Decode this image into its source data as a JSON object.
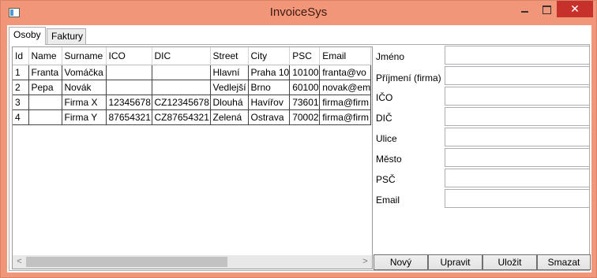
{
  "window": {
    "title": "InvoiceSys",
    "close_glyph": "✕"
  },
  "tabs": [
    {
      "label": "Osoby",
      "active": true
    },
    {
      "label": "Faktury",
      "active": false
    }
  ],
  "grid": {
    "columns": [
      "Id",
      "Name",
      "Surname",
      "ICO",
      "DIC",
      "Street",
      "City",
      "PSC",
      "Email"
    ],
    "rows": [
      [
        "1",
        "Franta",
        "Vomáčka",
        "",
        "",
        "Hlavní",
        "Praha 10",
        "10100",
        "franta@vo"
      ],
      [
        "2",
        "Pepa",
        "Novák",
        "",
        "",
        "Vedlejší",
        "Brno",
        "60100",
        "novak@em"
      ],
      [
        "3",
        "",
        "Firma X",
        "12345678",
        "CZ12345678",
        "Dlouhá",
        "Havířov",
        "73601",
        "firma@firm"
      ],
      [
        "4",
        "",
        "Firma Y",
        "87654321",
        "CZ87654321",
        "Zelená",
        "Ostrava",
        "70002",
        "firma@firm"
      ]
    ],
    "scroll_left_glyph": "<",
    "scroll_right_glyph": ">"
  },
  "form": {
    "fields": [
      {
        "label": "Jméno",
        "value": ""
      },
      {
        "label": "Příjmení (firma)",
        "value": ""
      },
      {
        "label": "IČO",
        "value": ""
      },
      {
        "label": "DIČ",
        "value": ""
      },
      {
        "label": "Ulice",
        "value": ""
      },
      {
        "label": "Město",
        "value": ""
      },
      {
        "label": "PSČ",
        "value": ""
      },
      {
        "label": "Email",
        "value": ""
      }
    ]
  },
  "actions": {
    "new_label": "Nový",
    "edit_label": "Upravit",
    "save_label": "Uložit",
    "delete_label": "Smazat"
  },
  "colors": {
    "title_bar": "#f2967a",
    "close_button": "#c7312b"
  }
}
